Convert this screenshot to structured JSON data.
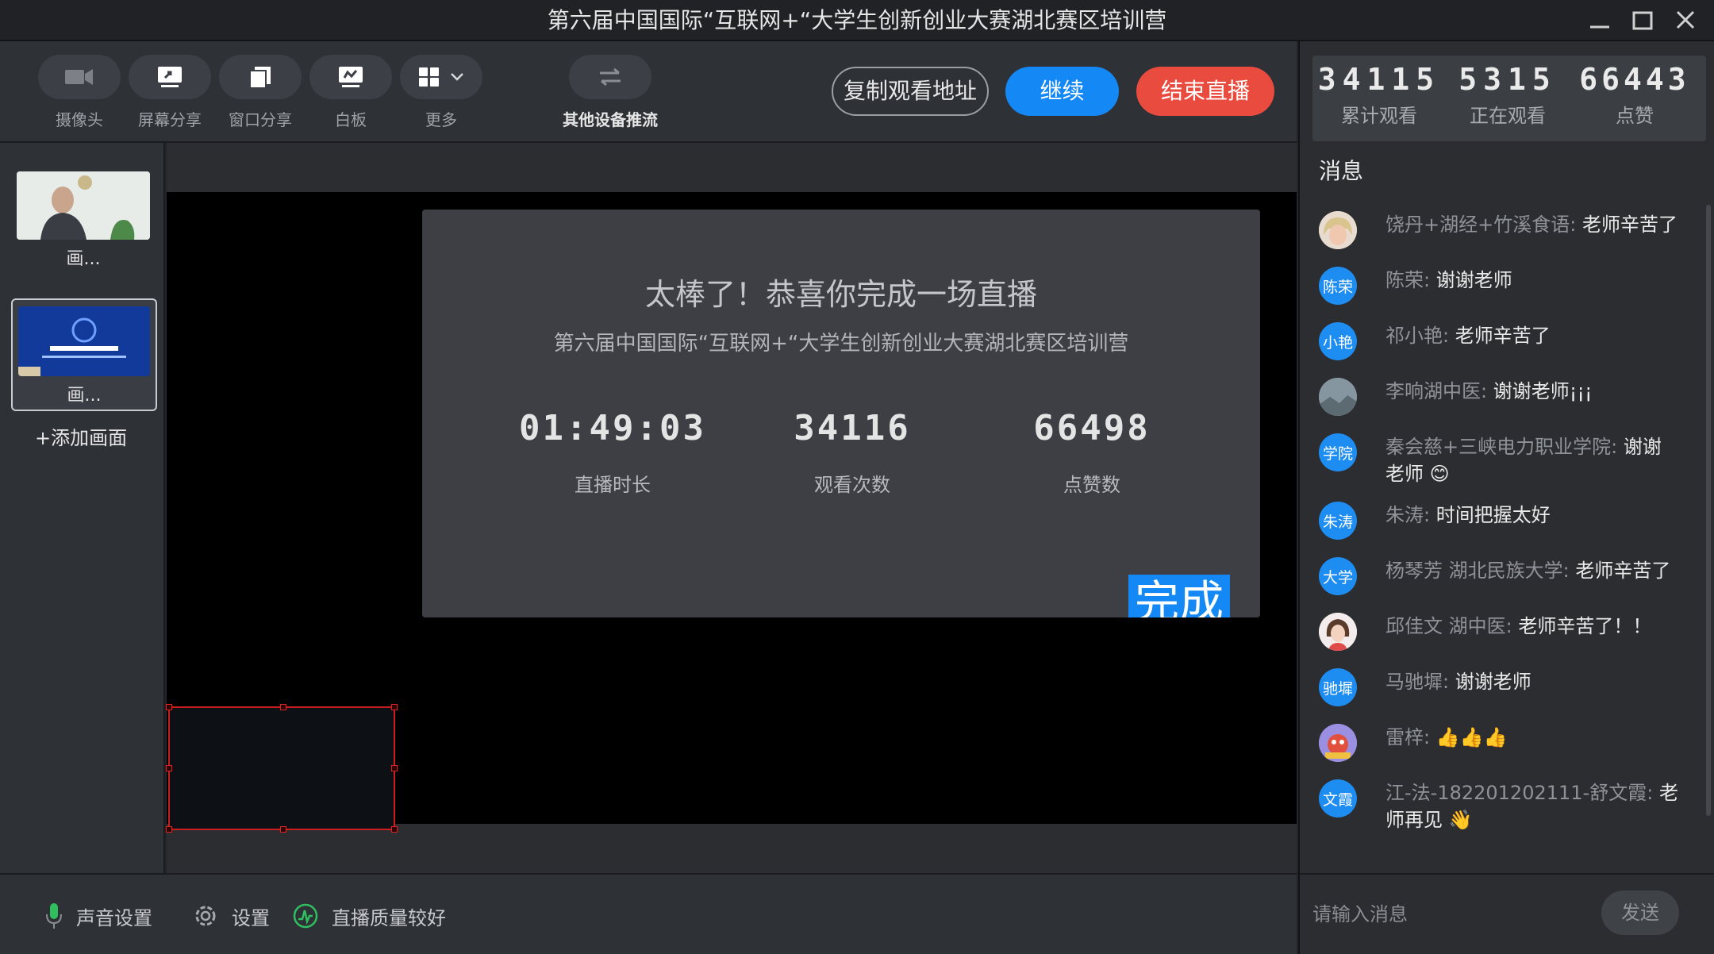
{
  "window": {
    "title": "第六届中国国际“互联网+“大学生创新创业大赛湖北赛区培训营"
  },
  "toolbar": {
    "camera_label": "摄像头",
    "screen_share_label": "屏幕分享",
    "window_share_label": "窗口分享",
    "whiteboard_label": "白板",
    "more_label": "更多",
    "other_device_label": "其他设备推流",
    "copy_url_label": "复制观看地址",
    "continue_label": "继续",
    "end_live_label": "结束直播"
  },
  "left_panel": {
    "thumbs": [
      {
        "label": "画..."
      },
      {
        "label": "画..."
      }
    ],
    "add_label": "+添加画面"
  },
  "dialog": {
    "title": "太棒了！恭喜你完成一场直播",
    "subtitle": "第六届中国国际“互联网+“大学生创新创业大赛湖北赛区培训营",
    "duration_value": "01:49:03",
    "duration_label": "直播时长",
    "views_value": "34116",
    "views_label": "观看次数",
    "likes_value": "66498",
    "likes_label": "点赞数",
    "done_label": "完成"
  },
  "bottom": {
    "audio_label": "声音设置",
    "settings_label": "设置",
    "quality_label": "直播质量较好"
  },
  "stats": {
    "total_value": "34115",
    "total_label": "累计观看",
    "online_value": "5315",
    "online_label": "正在观看",
    "likes_value": "66443",
    "likes_label": "点赞"
  },
  "messages_heading": "消息",
  "messages": [
    {
      "avatar": "",
      "avatar_style": "photo-hair",
      "name": "饶丹+湖经+竹溪食语:",
      "text": "老师辛苦了"
    },
    {
      "avatar": "陈荣",
      "avatar_style": "blue",
      "name": "陈荣:",
      "text": "谢谢老师"
    },
    {
      "avatar": "小艳",
      "avatar_style": "blue",
      "name": "祁小艳:",
      "text": "老师辛苦了"
    },
    {
      "avatar": "",
      "avatar_style": "photo-landscape",
      "name": "李响湖中医:",
      "text": "谢谢老师¡¡¡"
    },
    {
      "avatar": "学院",
      "avatar_style": "blue",
      "name": "秦会慈+三峡电力职业学院:",
      "text": "谢谢老师 😊"
    },
    {
      "avatar": "朱涛",
      "avatar_style": "blue",
      "name": "朱涛:",
      "text": "时间把握太好"
    },
    {
      "avatar": "大学",
      "avatar_style": "blue",
      "name": "杨琴芳 湖北民族大学:",
      "text": "老师辛苦了"
    },
    {
      "avatar": "",
      "avatar_style": "photo-girl",
      "name": "邱佳文 湖中医:",
      "text": "老师辛苦了！！"
    },
    {
      "avatar": "驰墀",
      "avatar_style": "blue",
      "name": "马驰墀:",
      "text": "谢谢老师"
    },
    {
      "avatar": "",
      "avatar_style": "photo-cartoon",
      "name": "雷梓:",
      "text": "👍👍👍"
    },
    {
      "avatar": "文霞",
      "avatar_style": "blue",
      "name": "江-法-182201202111-舒文霞:",
      "text": "老师再见 👋"
    }
  ],
  "chat": {
    "placeholder": "请输入消息",
    "send_label": "发送"
  },
  "colors": {
    "accent_blue": "#1489f5",
    "danger_red": "#e94b3f",
    "status_green": "#2fbf5f"
  }
}
